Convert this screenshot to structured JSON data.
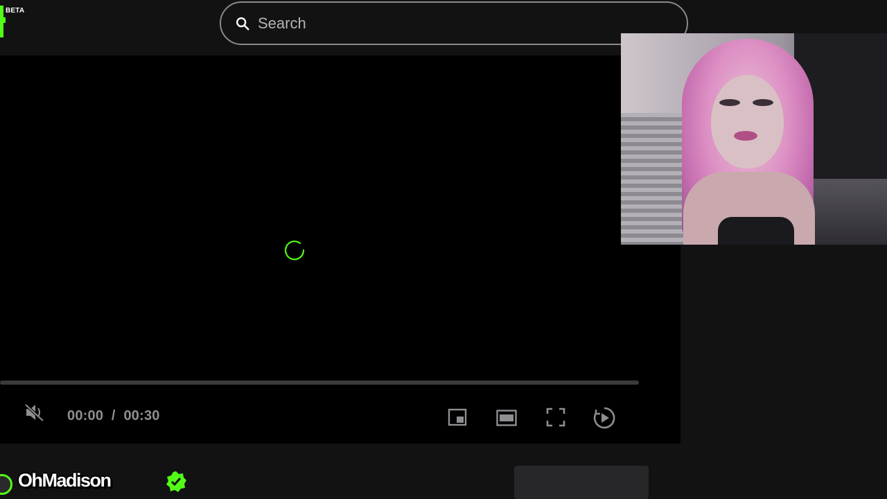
{
  "header": {
    "badge": "BETA",
    "search": {
      "placeholder": "Search",
      "value": ""
    }
  },
  "player": {
    "state": "loading",
    "progress": 0,
    "time_current": "00:00",
    "time_separator": "/",
    "time_total": "00:30",
    "muted": true,
    "icons": [
      "muted-speaker-icon",
      "mini-player-icon",
      "theater-mode-icon",
      "fullscreen-icon",
      "autoplay-icon"
    ]
  },
  "channel": {
    "name": "OhMadison",
    "verified": true
  },
  "colors": {
    "accent": "#53fc18",
    "background": "#121213",
    "player_bg": "#000000",
    "control_icon": "#8f8f93"
  }
}
